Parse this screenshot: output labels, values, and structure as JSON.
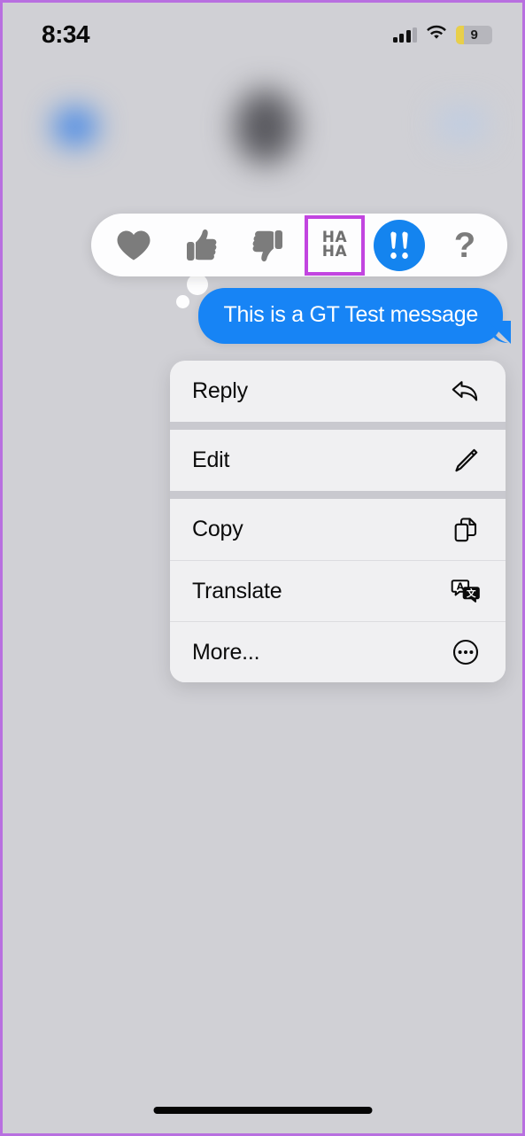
{
  "status_bar": {
    "time": "8:34",
    "signal_icon": "cellular-signal-icon",
    "wifi_icon": "wifi-icon",
    "battery_level": "9",
    "battery_icon": "battery-low-power-icon",
    "battery_fill_color": "#e8cf4a"
  },
  "nav_bar": {
    "back_icon": "back-chevron-icon",
    "avatar": "contact-avatar",
    "right_control": "facetime-button"
  },
  "reaction_bar": {
    "reactions": [
      {
        "id": "heart",
        "icon": "heart-icon",
        "label": "Love",
        "state": "default"
      },
      {
        "id": "thumbsup",
        "icon": "thumbs-up-icon",
        "label": "Like",
        "state": "default"
      },
      {
        "id": "thumbsdown",
        "icon": "thumbs-down-icon",
        "label": "Dislike",
        "state": "default"
      },
      {
        "id": "haha",
        "icon": "haha-icon",
        "label": "HA HA",
        "state": "highlighted"
      },
      {
        "id": "exclamation",
        "icon": "double-exclamation-icon",
        "label": "Emphasize",
        "state": "selected"
      },
      {
        "id": "question",
        "icon": "question-mark-icon",
        "label": "Question",
        "state": "default"
      }
    ],
    "haha_line1": "HA",
    "haha_line2": "HA",
    "question_glyph": "?",
    "highlight_color": "#c245e0",
    "selected_color": "#1484ef"
  },
  "message": {
    "text": "This is a GT Test message",
    "bubble_color": "#1784f5",
    "text_color": "#ffffff",
    "alignment": "outgoing"
  },
  "context_menu": {
    "groups": [
      {
        "items": [
          {
            "label": "Reply",
            "icon": "reply-arrow-icon"
          }
        ]
      },
      {
        "items": [
          {
            "label": "Edit",
            "icon": "pencil-icon"
          }
        ]
      },
      {
        "items": [
          {
            "label": "Copy",
            "icon": "copy-documents-icon"
          },
          {
            "label": "Translate",
            "icon": "translate-icon"
          },
          {
            "label": "More...",
            "icon": "ellipsis-circle-icon"
          }
        ]
      }
    ]
  },
  "home_indicator": {
    "label": "home-indicator"
  }
}
